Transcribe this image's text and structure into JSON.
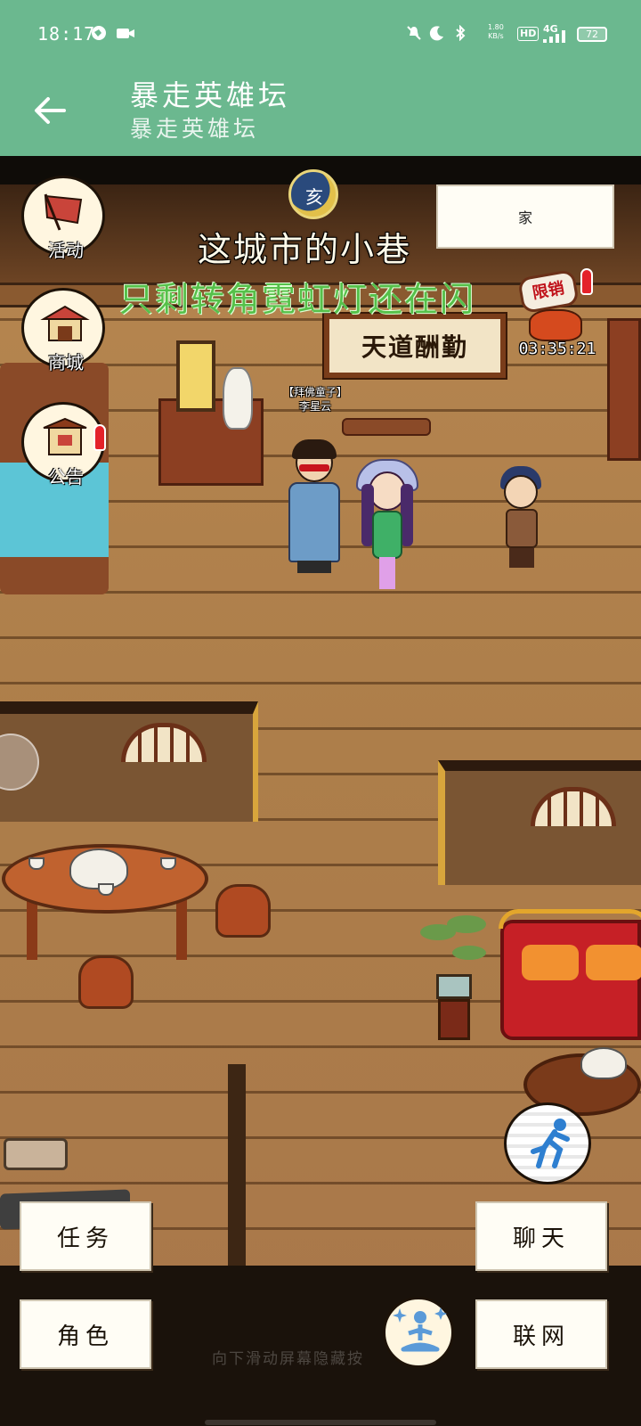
{
  "status_bar": {
    "time": "18:17",
    "network_speed_value": "1.80",
    "network_speed_unit": "KB/s",
    "hd_label": "HD",
    "signal_label": "4G",
    "battery": "72"
  },
  "app_bar": {
    "title": "暴走英雄坛",
    "subtitle": "暴走英雄坛"
  },
  "game": {
    "zodiac_hour": "亥",
    "location_title": "这城市的小巷",
    "subtitle_overlay": "只剩转角霓虹灯还在闪",
    "home_button": "家",
    "plaque_text": "天道酬勤",
    "limited_offer": {
      "label": "限销",
      "timer": "03:35:21"
    },
    "npc_name_tag": {
      "title": "【拜佛童子】",
      "name": "李星云"
    },
    "side_menu": [
      {
        "label": "活动",
        "icon": "flag-icon"
      },
      {
        "label": "商城",
        "icon": "shop-icon"
      },
      {
        "label": "公告",
        "icon": "gate-icon"
      }
    ],
    "commands": {
      "task": "任务",
      "chat": "聊天",
      "character": "角色",
      "network": "联网"
    },
    "hint_text": "向下滑动屏幕隐藏按"
  },
  "colors": {
    "header_green": "#6bb88f",
    "floor_wood": "#b68650",
    "subtitle_green": "#56c04a",
    "badge_red": "#e4222a"
  }
}
